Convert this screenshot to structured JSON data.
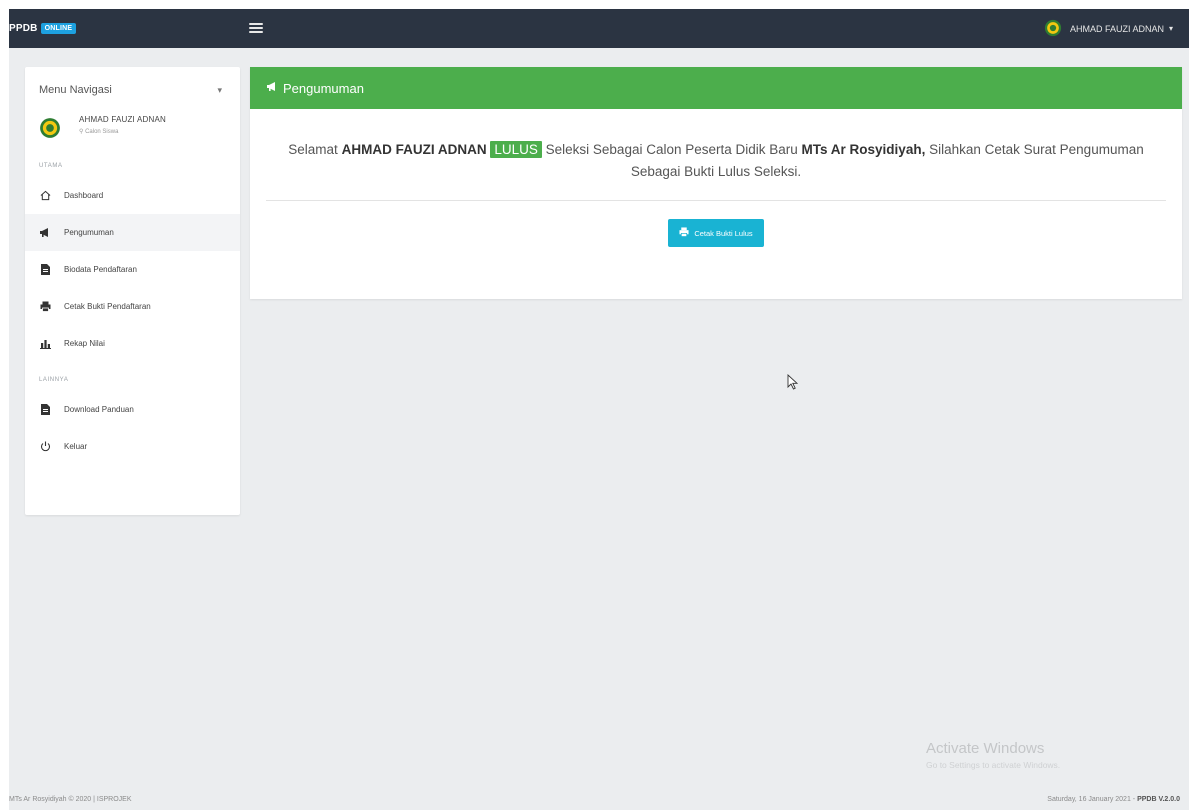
{
  "header": {
    "brand": "PPDB",
    "brand_badge": "ONLINE",
    "user_name": "AHMAD FAUZI ADNAN"
  },
  "sidebar": {
    "title": "Menu Navigasi",
    "user_name": "AHMAD FAUZI ADNAN",
    "user_role": "Calon Siswa",
    "section_main": "UTAMA",
    "items": [
      {
        "label": "Dashboard",
        "icon": "home-icon"
      },
      {
        "label": "Pengumuman",
        "icon": "megaphone-icon",
        "active": true
      },
      {
        "label": "Biodata Pendaftaran",
        "icon": "file-icon"
      },
      {
        "label": "Cetak Bukti Pendaftaran",
        "icon": "print-icon"
      },
      {
        "label": "Rekap Nilai",
        "icon": "chart-icon"
      }
    ],
    "section_other": "LAINNYA",
    "items_other": [
      {
        "label": "Download Panduan",
        "icon": "file-icon"
      },
      {
        "label": "Keluar",
        "icon": "power-icon"
      }
    ]
  },
  "panel": {
    "title": "Pengumuman",
    "text_1": "Selamat",
    "name": "AHMAD FAUZI ADNAN",
    "status": "LULUS",
    "text_2": "Seleksi Sebagai Calon Peserta Didik Baru",
    "school": "MTs Ar Rosyidiyah,",
    "text_3": "Silahkan Cetak Surat Pengumuman Sebagai Bukti Lulus Seleksi.",
    "button_label": "Cetak Bukti Lulus"
  },
  "watermark": {
    "line1": "Activate Windows",
    "line2": "Go to Settings to activate Windows."
  },
  "footer": {
    "left": "MTs Ar Rosyidiyah © 2020 | ISPROJEK",
    "right_date": "Saturday, 16 January 2021 - ",
    "right_version": "PPDB V.2.0.0"
  },
  "colors": {
    "topbar": "#2b3442",
    "accent_green": "#4cae4c",
    "button_cyan": "#19b3d3",
    "badge_blue": "#1da1e0"
  }
}
